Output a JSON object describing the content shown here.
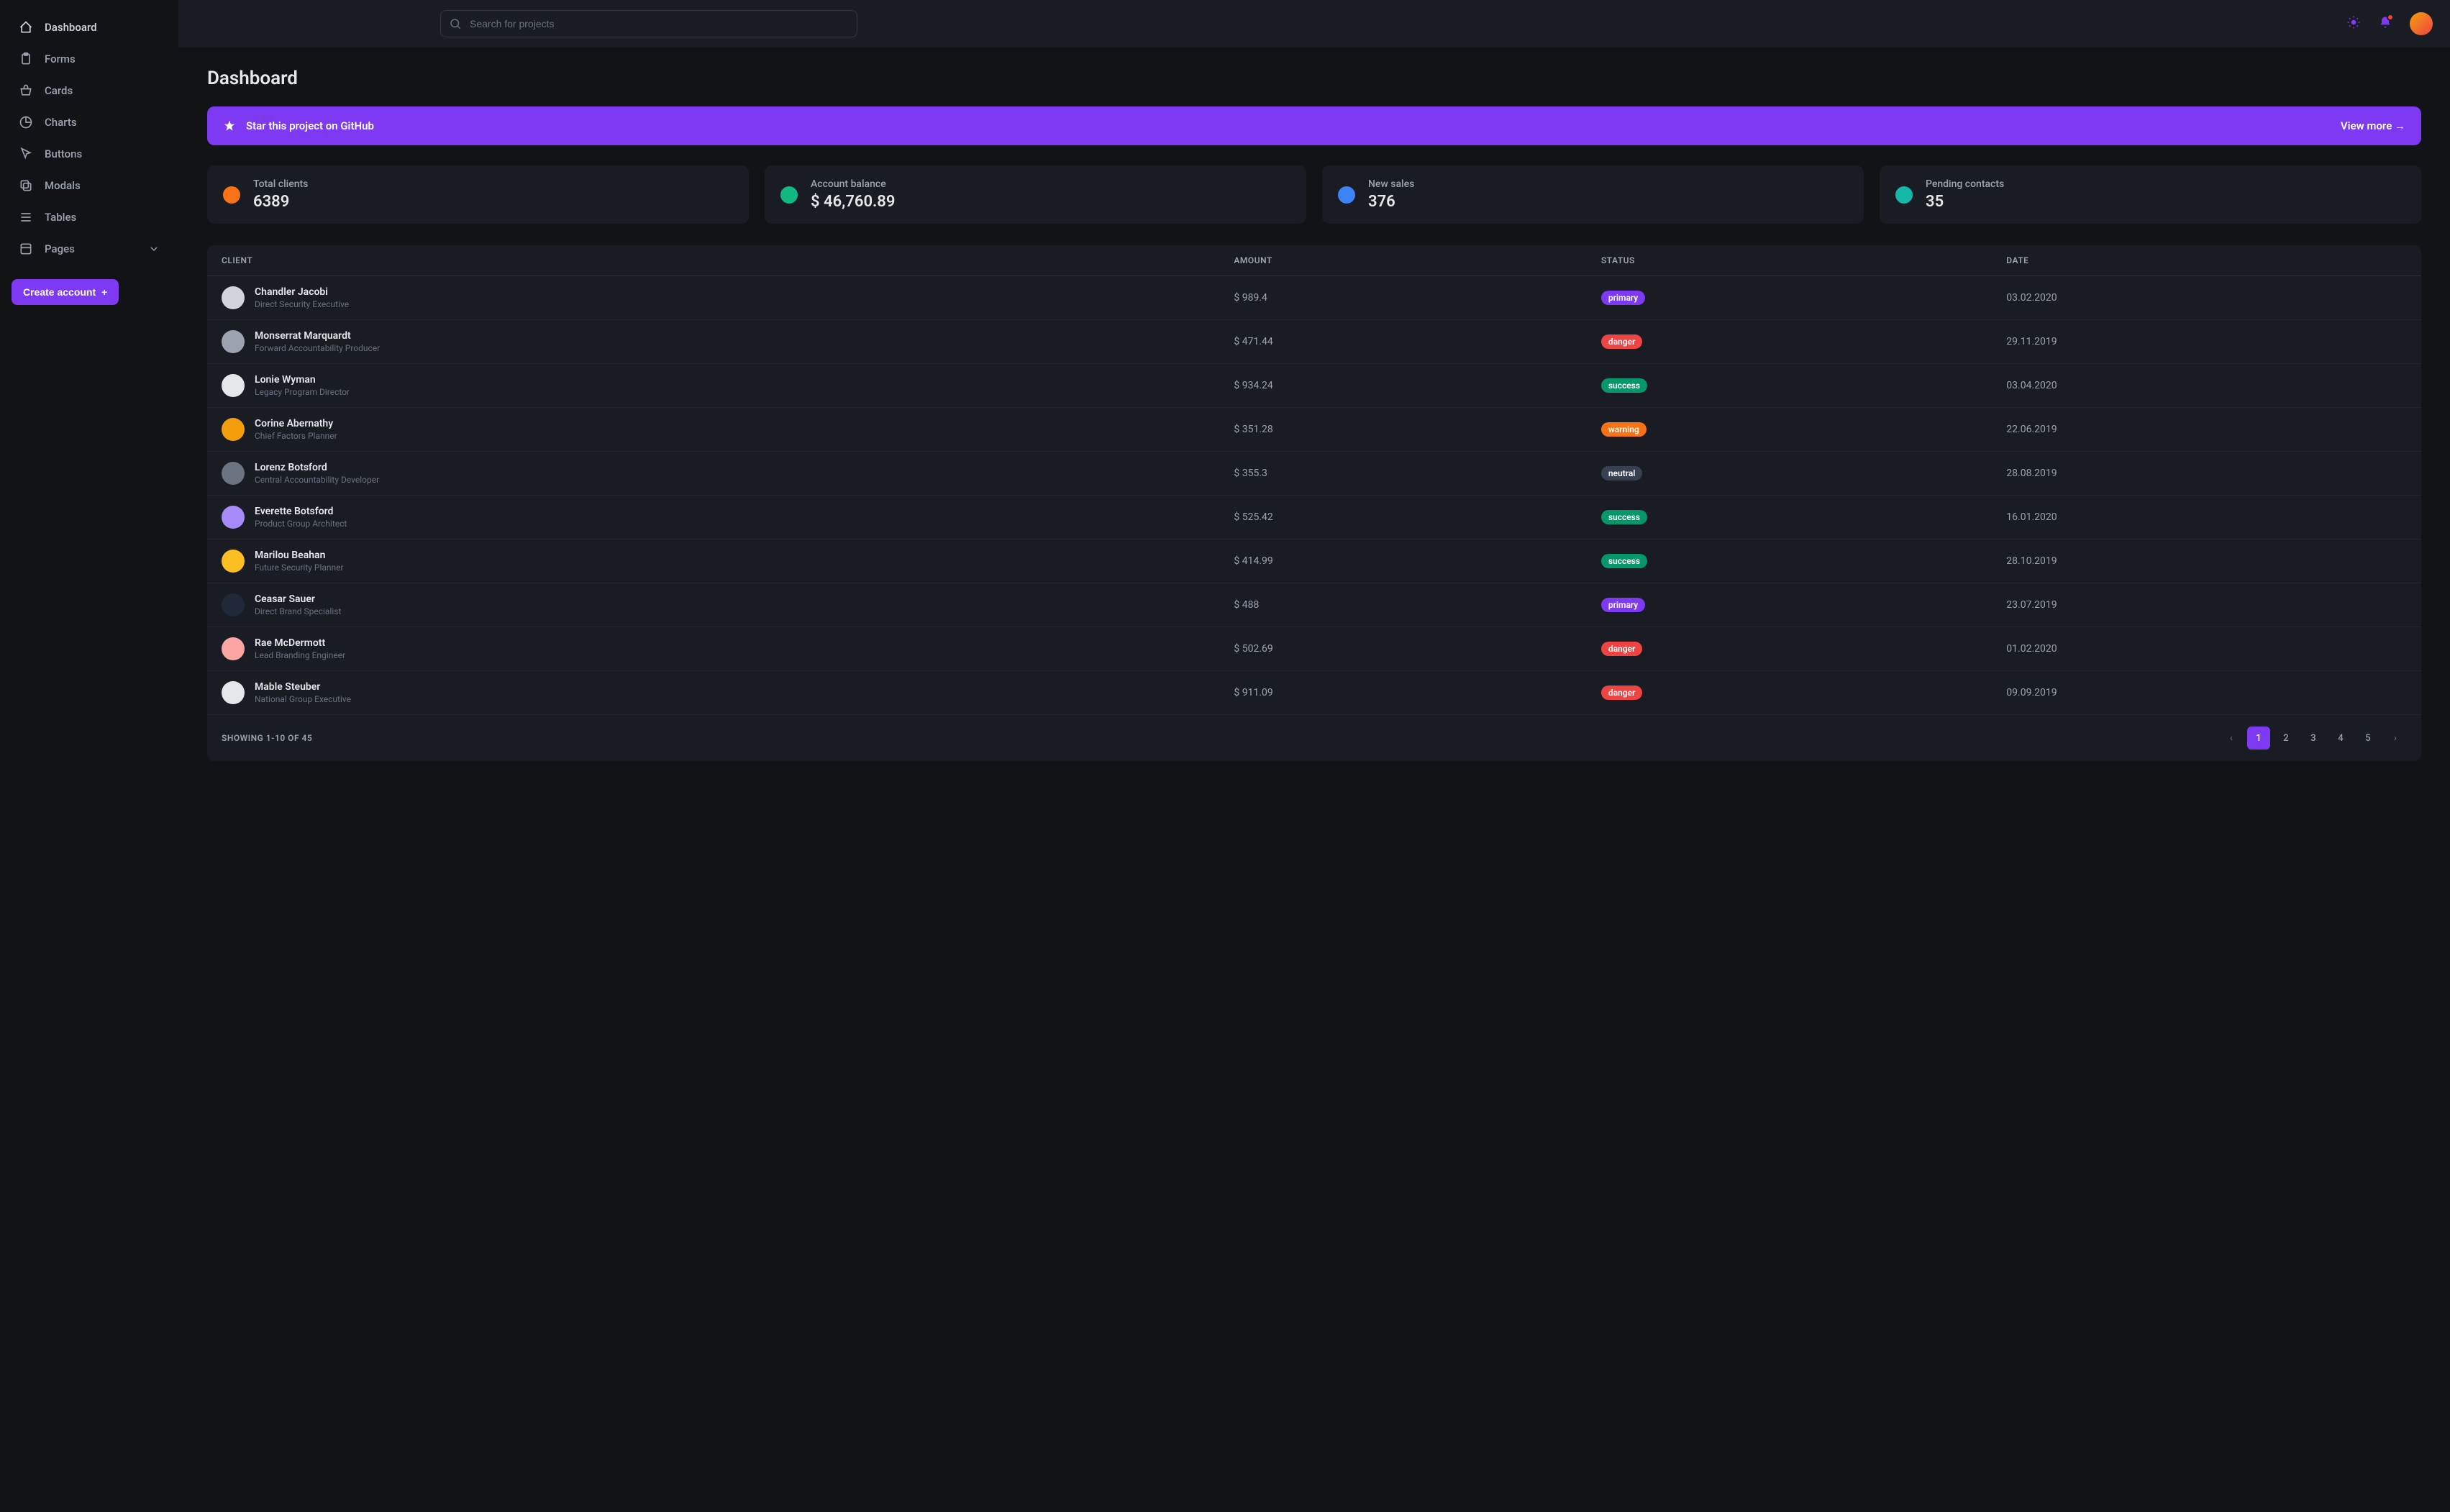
{
  "search": {
    "placeholder": "Search for projects"
  },
  "sidebar": {
    "items": [
      {
        "label": "Dashboard"
      },
      {
        "label": "Forms"
      },
      {
        "label": "Cards"
      },
      {
        "label": "Charts"
      },
      {
        "label": "Buttons"
      },
      {
        "label": "Modals"
      },
      {
        "label": "Tables"
      },
      {
        "label": "Pages"
      }
    ],
    "create_label": "Create account"
  },
  "page": {
    "title": "Dashboard"
  },
  "banner": {
    "text": "Star this project on GitHub",
    "link": "View more →"
  },
  "stats": [
    {
      "label": "Total clients",
      "value": "6389",
      "color": "#f97316"
    },
    {
      "label": "Account balance",
      "value": "$ 46,760.89",
      "color": "#10b981"
    },
    {
      "label": "New sales",
      "value": "376",
      "color": "#3b82f6"
    },
    {
      "label": "Pending contacts",
      "value": "35",
      "color": "#14b8a6"
    }
  ],
  "table": {
    "headers": {
      "client": "Client",
      "amount": "Amount",
      "status": "Status",
      "date": "Date"
    },
    "rows": [
      {
        "name": "Chandler Jacobi",
        "role": "Direct Security Executive",
        "amount": "$ 989.4",
        "status": "primary",
        "date": "03.02.2020"
      },
      {
        "name": "Monserrat Marquardt",
        "role": "Forward Accountability Producer",
        "amount": "$ 471.44",
        "status": "danger",
        "date": "29.11.2019"
      },
      {
        "name": "Lonie Wyman",
        "role": "Legacy Program Director",
        "amount": "$ 934.24",
        "status": "success",
        "date": "03.04.2020"
      },
      {
        "name": "Corine Abernathy",
        "role": "Chief Factors Planner",
        "amount": "$ 351.28",
        "status": "warning",
        "date": "22.06.2019"
      },
      {
        "name": "Lorenz Botsford",
        "role": "Central Accountability Developer",
        "amount": "$ 355.3",
        "status": "neutral",
        "date": "28.08.2019"
      },
      {
        "name": "Everette Botsford",
        "role": "Product Group Architect",
        "amount": "$ 525.42",
        "status": "success",
        "date": "16.01.2020"
      },
      {
        "name": "Marilou Beahan",
        "role": "Future Security Planner",
        "amount": "$ 414.99",
        "status": "success",
        "date": "28.10.2019"
      },
      {
        "name": "Ceasar Sauer",
        "role": "Direct Brand Specialist",
        "amount": "$ 488",
        "status": "primary",
        "date": "23.07.2019"
      },
      {
        "name": "Rae McDermott",
        "role": "Lead Branding Engineer",
        "amount": "$ 502.69",
        "status": "danger",
        "date": "01.02.2020"
      },
      {
        "name": "Mable Steuber",
        "role": "National Group Executive",
        "amount": "$ 911.09",
        "status": "danger",
        "date": "09.09.2019"
      }
    ],
    "footer": "Showing 1-10 of 45",
    "pages": [
      "1",
      "2",
      "3",
      "4",
      "5"
    ]
  }
}
